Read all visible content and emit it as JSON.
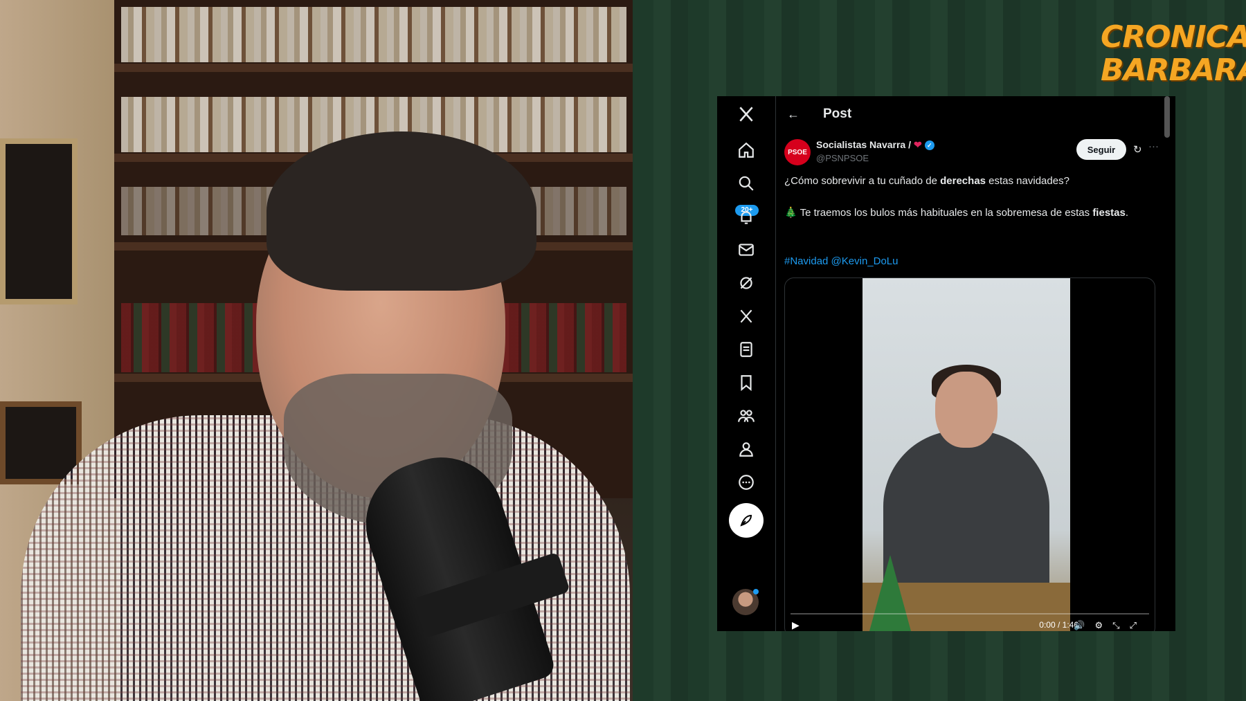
{
  "logo": {
    "line1": "CRONICAS",
    "line2": "BARBARAS"
  },
  "nav": {
    "notifications_badge": "20+",
    "items": [
      "x-logo",
      "home",
      "explore",
      "notifications",
      "messages",
      "grok",
      "premium",
      "lists",
      "bookmarks",
      "communities",
      "profile",
      "more"
    ]
  },
  "topbar": {
    "title": "Post",
    "back_icon": "←"
  },
  "post": {
    "author_avatar_text": "PSOE",
    "author_name": "Socialistas Navarra /",
    "author_handle": "@PSNPSOE",
    "follow_label": "Seguir",
    "line1_pre": "¿Cómo sobrevivir a tu cuñado de ",
    "line1_bold": "derechas",
    "line1_post": " estas navidades?",
    "line2_emoji": "🎄",
    "line2_text": " Te traemos los bulos más habituales en la sobremesa de estas ",
    "line2_bold": "fiestas",
    "line2_end": ".",
    "hashtags": "#Navidad @Kevin_DoLu"
  },
  "video": {
    "time": "0:00 / 1:46",
    "play_icon": "▶"
  },
  "colors": {
    "accent": "#1d9bf0",
    "logo": "#f5a623",
    "bg_green": "#1e3a2a"
  }
}
